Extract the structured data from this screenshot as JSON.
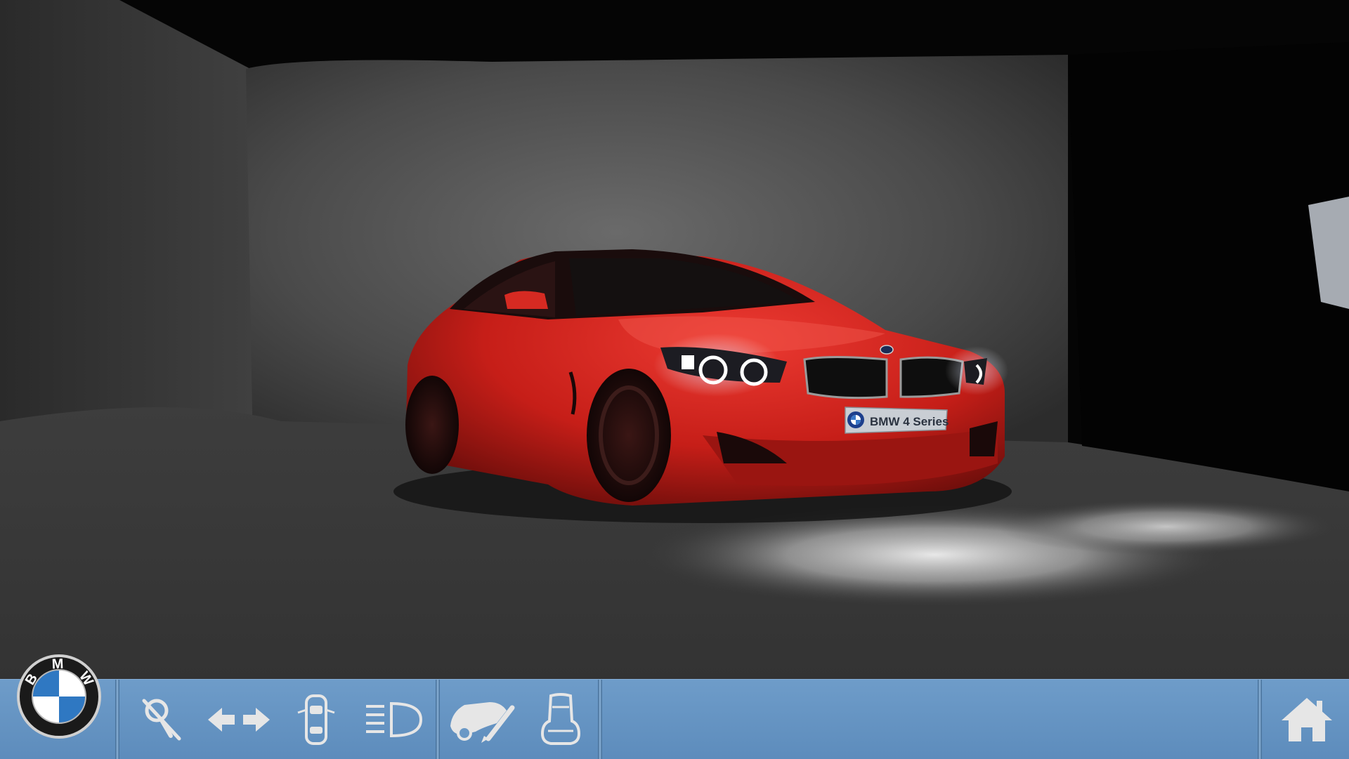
{
  "scene": {
    "license_plate": "BMW 4 Series",
    "car_color": "#d8231e",
    "wall_color": "#4b4b4b"
  },
  "brand": {
    "logo_letters": [
      "B",
      "M",
      "W"
    ],
    "logo_icon": "bmw-roundel-icon"
  },
  "toolbar": {
    "background": "#6a98c6",
    "icon_color": "#e6e6e6",
    "buttons": [
      {
        "id": "no-wipers",
        "icon": "no-key-icon"
      },
      {
        "id": "doors",
        "icon": "doors-open-icon"
      },
      {
        "id": "car-top",
        "icon": "car-top-view-icon"
      },
      {
        "id": "headlights",
        "icon": "headlight-icon"
      },
      {
        "id": "paint",
        "icon": "paint-car-icon"
      },
      {
        "id": "seat",
        "icon": "seat-icon"
      },
      {
        "id": "home",
        "icon": "home-icon"
      }
    ]
  }
}
